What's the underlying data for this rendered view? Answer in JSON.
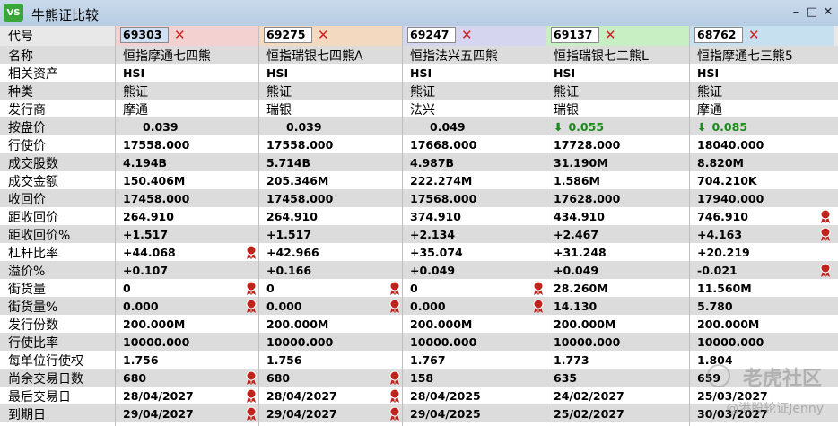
{
  "window": {
    "title": "牛熊证比较",
    "logo": "VS"
  },
  "columns": [
    {
      "code": "69303",
      "selected": true,
      "header_color": "#f3d1d1"
    },
    {
      "code": "69275",
      "selected": false,
      "header_color": "#f3d9bf"
    },
    {
      "code": "69247",
      "selected": false,
      "header_color": "#d6d5ef"
    },
    {
      "code": "69137",
      "selected": false,
      "header_color": "#c8eec3"
    },
    {
      "code": "68762",
      "selected": false,
      "header_color": "#c7e0ef"
    }
  ],
  "rows": [
    {
      "label": "代号"
    },
    {
      "label": "名称",
      "normal": true,
      "values": [
        "恒指摩通七四熊",
        "恒指瑞银七四熊A",
        "恒指法兴五四熊",
        "恒指瑞银七二熊L",
        "恒指摩通七三熊5"
      ]
    },
    {
      "label": "相关资产",
      "values": [
        "HSI",
        "HSI",
        "HSI",
        "HSI",
        "HSI"
      ]
    },
    {
      "label": "种类",
      "normal": true,
      "values": [
        "熊证",
        "熊证",
        "熊证",
        "熊证",
        "熊证"
      ]
    },
    {
      "label": "发行商",
      "normal": true,
      "values": [
        "摩通",
        "瑞银",
        "法兴",
        "瑞银",
        "摩通"
      ]
    },
    {
      "label": "按盘价",
      "values": [
        "0.039",
        "0.039",
        "0.049",
        "0.055",
        "0.085"
      ],
      "down": [
        false,
        false,
        false,
        true,
        true
      ]
    },
    {
      "label": "行使价",
      "values": [
        "17558.000",
        "17558.000",
        "17668.000",
        "17728.000",
        "18040.000"
      ]
    },
    {
      "label": "成交股数",
      "values": [
        "4.194B",
        "5.714B",
        "4.987B",
        "31.190M",
        "8.820M"
      ]
    },
    {
      "label": "成交金额",
      "values": [
        "150.406M",
        "205.346M",
        "222.274M",
        "1.586M",
        "704.210K"
      ]
    },
    {
      "label": "收回价",
      "values": [
        "17458.000",
        "17458.000",
        "17568.000",
        "17628.000",
        "17940.000"
      ]
    },
    {
      "label": "距收回价",
      "values": [
        "264.910",
        "264.910",
        "374.910",
        "434.910",
        "746.910"
      ],
      "ribbon": [
        false,
        false,
        false,
        false,
        true
      ]
    },
    {
      "label": "距收回价%",
      "values": [
        "+1.517",
        "+1.517",
        "+2.134",
        "+2.467",
        "+4.163"
      ],
      "ribbon": [
        false,
        false,
        false,
        false,
        true
      ]
    },
    {
      "label": "杠杆比率",
      "values": [
        "+44.068",
        "+42.966",
        "+35.074",
        "+31.248",
        "+20.219"
      ],
      "ribbon": [
        true,
        false,
        false,
        false,
        false
      ]
    },
    {
      "label": "溢价%",
      "values": [
        "+0.107",
        "+0.166",
        "+0.049",
        "+0.049",
        "-0.021"
      ],
      "ribbon": [
        false,
        false,
        false,
        false,
        true
      ]
    },
    {
      "label": "街货量",
      "values": [
        "0",
        "0",
        "0",
        "28.260M",
        "11.560M"
      ],
      "ribbon": [
        true,
        true,
        true,
        false,
        false
      ]
    },
    {
      "label": "街货量%",
      "values": [
        "0.000",
        "0.000",
        "0.000",
        "14.130",
        "5.780"
      ],
      "ribbon": [
        true,
        true,
        true,
        false,
        false
      ]
    },
    {
      "label": "发行份数",
      "values": [
        "200.000M",
        "200.000M",
        "200.000M",
        "200.000M",
        "200.000M"
      ]
    },
    {
      "label": "行使比率",
      "values": [
        "10000.000",
        "10000.000",
        "10000.000",
        "10000.000",
        "10000.000"
      ]
    },
    {
      "label": "每单位行使权",
      "values": [
        "1.756",
        "1.756",
        "1.767",
        "1.773",
        "1.804"
      ]
    },
    {
      "label": "尚余交易日数",
      "values": [
        "680",
        "680",
        "158",
        "635",
        "659"
      ],
      "ribbon": [
        true,
        true,
        false,
        false,
        false
      ]
    },
    {
      "label": "最后交易日",
      "values": [
        "28/04/2027",
        "28/04/2027",
        "28/04/2025",
        "24/02/2027",
        "25/03/2027"
      ],
      "ribbon": [
        true,
        true,
        false,
        false,
        false
      ]
    },
    {
      "label": "到期日",
      "values": [
        "29/04/2027",
        "29/04/2027",
        "29/04/2025",
        "25/02/2027",
        "30/03/2027"
      ],
      "ribbon": [
        true,
        true,
        false,
        false,
        false
      ]
    }
  ],
  "watermark": {
    "brand": "老虎社区",
    "author": "@港股轮证Jenny"
  },
  "colors": {
    "down": "#1d8a1d",
    "remove": "#d42020",
    "ribbon": "#c0241f"
  }
}
